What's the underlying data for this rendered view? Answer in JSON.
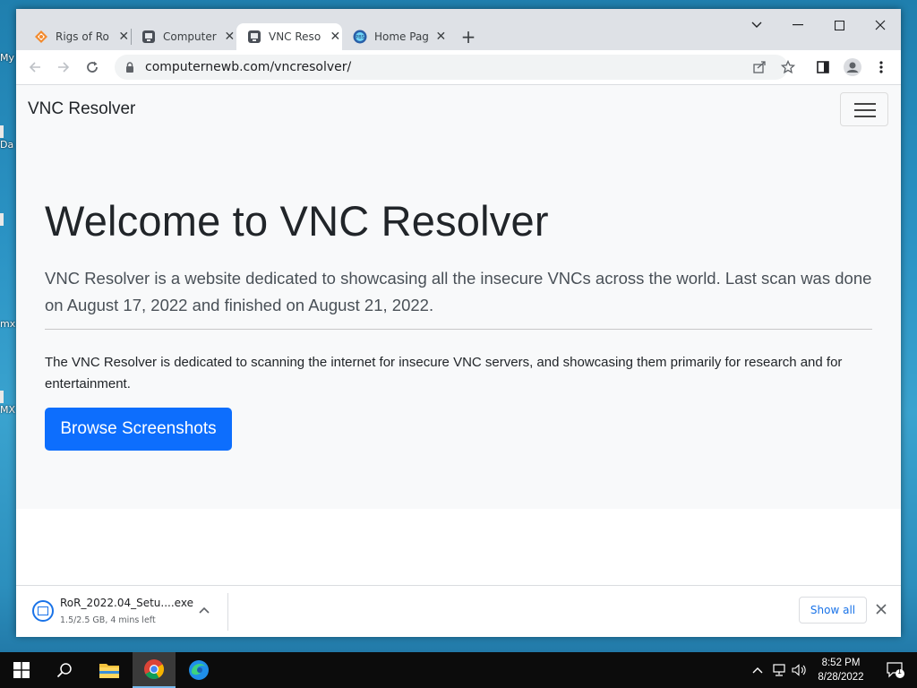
{
  "desktop": {
    "icon_labels": [
      "My",
      "Da",
      "",
      "mx",
      "MX"
    ]
  },
  "browser": {
    "tabs": [
      {
        "title": "Rigs of Ro",
        "icon": "rigs-of-rods-icon"
      },
      {
        "title": "Computer",
        "icon": "computernewb-icon"
      },
      {
        "title": "VNC Reso",
        "icon": "computernewb-icon",
        "active": true
      },
      {
        "title": "Home Pag",
        "icon": "pbs-kids-icon"
      }
    ],
    "new_tab": "+",
    "url": "computernewb.com/vncresolver/"
  },
  "page": {
    "brand": "VNC Resolver",
    "headline": "Welcome to VNC Resolver",
    "lead": "VNC Resolver is a website dedicated to showcasing all the insecure VNCs across the world. Last scan was done on August 17, 2022 and finished on August 21, 2022.",
    "description": "The VNC Resolver is dedicated to scanning the internet for insecure VNC servers, and showcasing them primarily for research and for entertainment.",
    "cta": "Browse Screenshots"
  },
  "download": {
    "filename": "RoR_2022.04_Setu....exe",
    "status": "1.5/2.5 GB, 4 mins left",
    "progress": 0.6,
    "show_all": "Show all"
  },
  "taskbar": {
    "time": "8:52 PM",
    "date": "8/28/2022",
    "notifications": "1"
  },
  "colors": {
    "accent": "#0d6efd",
    "chrome_blue": "#1a73e8"
  }
}
